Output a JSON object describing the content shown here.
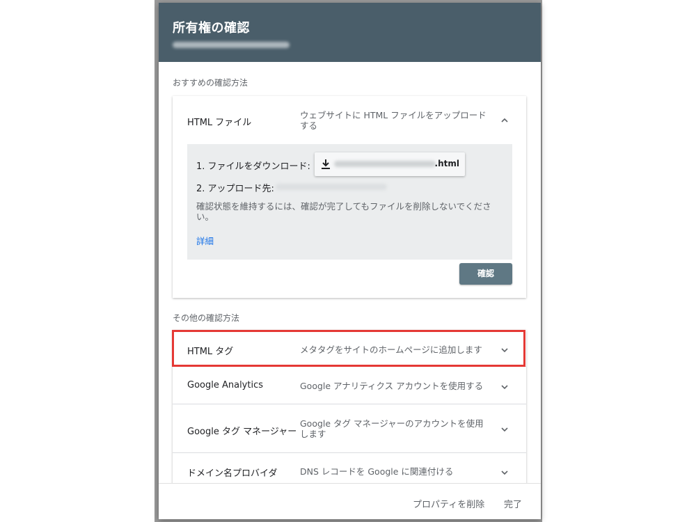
{
  "dialog": {
    "title": "所有権の確認"
  },
  "recommended": {
    "section_label": "おすすめの確認方法",
    "method": {
      "title": "HTML ファイル",
      "description": "ウェブサイトに HTML ファイルをアップロードする",
      "step1_label": "1. ファイルをダウンロード:",
      "download_filename": ".html",
      "step2_label": "2. アップロード先:",
      "note": "確認状態を維持するには、確認が完了してもファイルを削除しないでください。",
      "details_link": "詳細",
      "confirm_label": "確認"
    }
  },
  "other": {
    "section_label": "その他の確認方法",
    "items": [
      {
        "title": "HTML タグ",
        "description": "メタタグをサイトのホームページに追加します"
      },
      {
        "title": "Google Analytics",
        "description": "Google アナリティクス アカウントを使用する"
      },
      {
        "title": "Google タグ マネージャー",
        "description": "Google タグ マネージャーのアカウントを使用します"
      },
      {
        "title": "ドメイン名プロバイダ",
        "description": "DNS レコードを Google に関連付ける"
      }
    ]
  },
  "footer": {
    "remove_label": "プロパティを削除",
    "done_label": "完了"
  },
  "colors": {
    "header_bg": "#4a5e6a",
    "highlight": "#e53935",
    "link": "#1a73e8",
    "confirm_bg": "#5f7884"
  },
  "icons": {
    "download": "download-icon",
    "expand": "chevron-down-icon",
    "collapse": "chevron-up-icon"
  }
}
